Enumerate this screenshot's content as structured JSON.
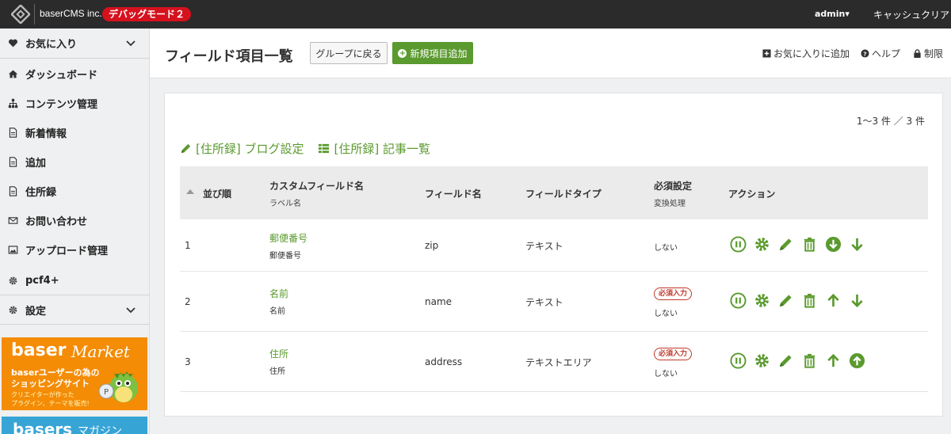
{
  "topbar": {
    "site_name": "baserCMS inc.",
    "debug_badge": "デバッグモード２",
    "admin": "admin▾",
    "cache_clear": "キャッシュクリア"
  },
  "sidebar": {
    "items": [
      {
        "label": "お気に入り",
        "icon": "heart-icon"
      },
      {
        "label": "ダッシュボード",
        "icon": "home-icon"
      },
      {
        "label": "コンテンツ管理",
        "icon": "sitemap-icon"
      },
      {
        "label": "新着情報",
        "icon": "document-icon"
      },
      {
        "label": "追加",
        "icon": "document-icon"
      },
      {
        "label": "住所録",
        "icon": "document-icon"
      },
      {
        "label": "お問い合わせ",
        "icon": "mail-icon"
      },
      {
        "label": "アップロード管理",
        "icon": "image-icon"
      },
      {
        "label": "pcf4+",
        "icon": "gear-icon"
      },
      {
        "label": "設定",
        "icon": "gear-icon"
      }
    ],
    "banner1": {
      "logo": "baser",
      "logo2": "Market",
      "line1": "baserユーザーの為の",
      "line2": "ショッピングサイト",
      "line3": "クリエイターが作った",
      "line4": "プラグイン、テーマを販売!"
    },
    "banner2": {
      "logo": "basers",
      "sub": "マガジン"
    }
  },
  "header": {
    "title": "フィールド項目一覧",
    "back_button": "グループに戻る",
    "add_button": "新規項目追加",
    "favorite_link": "お気に入りに追加",
    "help_link": "ヘルプ",
    "lock_link": "制限"
  },
  "content": {
    "count": "1〜3 件 ／ 3 件",
    "links": [
      {
        "label": "[住所録] ブログ設定",
        "icon": "pencil-icon"
      },
      {
        "label": "[住所録] 記事一覧",
        "icon": "list-icon"
      }
    ],
    "columns": {
      "order": "並び順",
      "custom_name": "カスタムフィールド名",
      "label_name": "ラベル名",
      "field_name": "フィールド名",
      "field_type": "フィールドタイプ",
      "required": "必須設定",
      "conversion": "変換処理",
      "actions": "アクション"
    },
    "rows": [
      {
        "order": "1",
        "name": "郵便番号",
        "label": "郵便番号",
        "field": "zip",
        "type": "テキスト",
        "required_badge": "",
        "conversion": "しない"
      },
      {
        "order": "2",
        "name": "名前",
        "label": "名前",
        "field": "name",
        "type": "テキスト",
        "required_badge": "必須入力",
        "conversion": "しない"
      },
      {
        "order": "3",
        "name": "住所",
        "label": "住所",
        "field": "address",
        "type": "テキストエリア",
        "required_badge": "必須入力",
        "conversion": "しない"
      }
    ]
  },
  "colors": {
    "accent": "#5a9a2e",
    "topbar": "#2b2b2b",
    "debug": "#d6111e",
    "required": "#c0392b"
  }
}
